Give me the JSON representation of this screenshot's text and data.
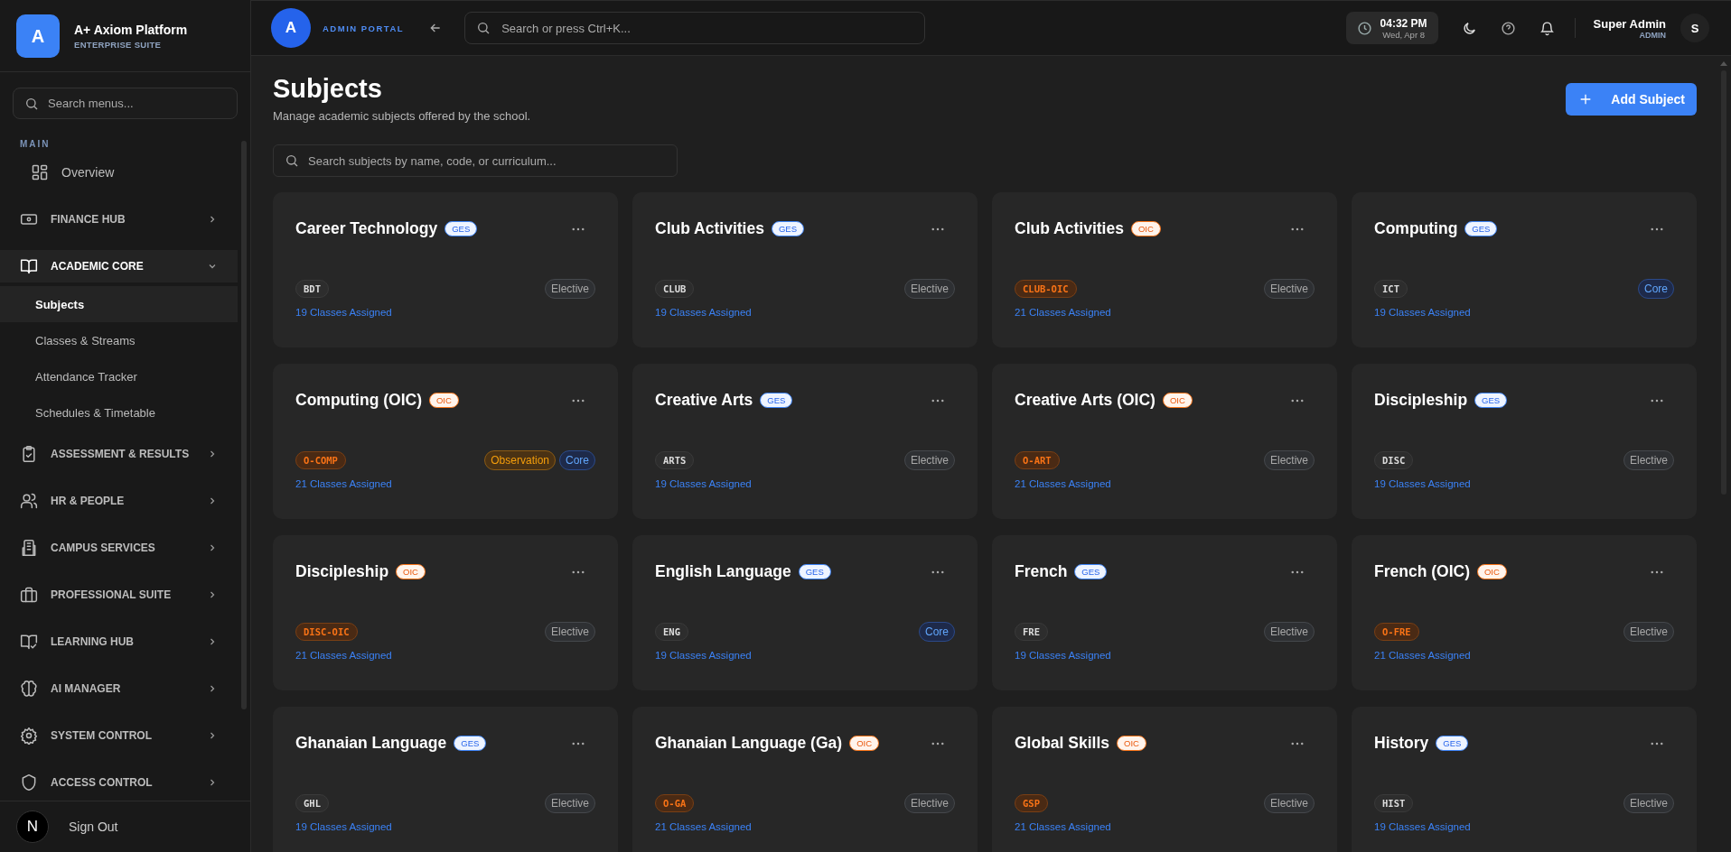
{
  "sidebar": {
    "brand": {
      "logo": "A",
      "title": "A+ Axiom Platform",
      "subtitle": "ENTERPRISE SUITE"
    },
    "search": {
      "placeholder": "Search menus..."
    },
    "section_label": "MAIN",
    "items": [
      {
        "label": "Overview",
        "kind": "link"
      },
      {
        "label": "FINANCE HUB",
        "kind": "group",
        "expanded": false
      },
      {
        "label": "ACADEMIC CORE",
        "kind": "group",
        "expanded": true,
        "children": [
          {
            "label": "Subjects",
            "selected": true
          },
          {
            "label": "Classes & Streams",
            "selected": false
          },
          {
            "label": "Attendance Tracker",
            "selected": false
          },
          {
            "label": "Schedules & Timetable",
            "selected": false
          }
        ]
      },
      {
        "label": "ASSESSMENT & RESULTS",
        "kind": "group",
        "expanded": false
      },
      {
        "label": "HR & PEOPLE",
        "kind": "group",
        "expanded": false
      },
      {
        "label": "CAMPUS SERVICES",
        "kind": "group",
        "expanded": false
      },
      {
        "label": "PROFESSIONAL SUITE",
        "kind": "group",
        "expanded": false
      },
      {
        "label": "LEARNING HUB",
        "kind": "group",
        "expanded": false
      },
      {
        "label": "AI MANAGER",
        "kind": "group",
        "expanded": false
      },
      {
        "label": "SYSTEM CONTROL",
        "kind": "group",
        "expanded": false
      },
      {
        "label": "ACCESS CONTROL",
        "kind": "group",
        "expanded": false
      }
    ],
    "footer": {
      "avatar": "N",
      "label": "Sign Out"
    }
  },
  "topbar": {
    "logo": "A",
    "portal": "ADMIN PORTAL",
    "search": {
      "placeholder": "Search or press Ctrl+K..."
    },
    "time": "04:32 PM",
    "date": "Wed, Apr 8",
    "user": {
      "name": "Super Admin",
      "role": "ADMIN",
      "avatar": "S"
    }
  },
  "page": {
    "title": "Subjects",
    "subtitle": "Manage academic subjects offered by the school.",
    "add_button": "Add Subject",
    "search": {
      "placeholder": "Search subjects by name, code, or curriculum..."
    }
  },
  "subjects": [
    {
      "name": "Career Technology",
      "badge": {
        "label": "GES",
        "kind": "ges"
      },
      "code": "BDT",
      "tags": [
        {
          "label": "Elective",
          "kind": "elective"
        }
      ],
      "classes": "19 Classes Assigned"
    },
    {
      "name": "Club Activities",
      "badge": {
        "label": "GES",
        "kind": "ges"
      },
      "code": "CLUB",
      "tags": [
        {
          "label": "Elective",
          "kind": "elective"
        }
      ],
      "classes": "19 Classes Assigned"
    },
    {
      "name": "Club Activities",
      "badge": {
        "label": "OIC",
        "kind": "oic"
      },
      "code": "CLUB-OIC",
      "tags": [
        {
          "label": "Elective",
          "kind": "elective"
        }
      ],
      "classes": "21 Classes Assigned"
    },
    {
      "name": "Computing",
      "badge": {
        "label": "GES",
        "kind": "ges"
      },
      "code": "ICT",
      "tags": [
        {
          "label": "Core",
          "kind": "core"
        }
      ],
      "classes": "19 Classes Assigned"
    },
    {
      "name": "Computing (OIC)",
      "badge": {
        "label": "OIC",
        "kind": "oic"
      },
      "code": "O-COMP",
      "tags": [
        {
          "label": "Observation",
          "kind": "observation"
        },
        {
          "label": "Core",
          "kind": "core"
        }
      ],
      "classes": "21 Classes Assigned"
    },
    {
      "name": "Creative Arts",
      "badge": {
        "label": "GES",
        "kind": "ges"
      },
      "code": "ARTS",
      "tags": [
        {
          "label": "Elective",
          "kind": "elective"
        }
      ],
      "classes": "19 Classes Assigned"
    },
    {
      "name": "Creative Arts (OIC)",
      "badge": {
        "label": "OIC",
        "kind": "oic"
      },
      "code": "O-ART",
      "tags": [
        {
          "label": "Elective",
          "kind": "elective"
        }
      ],
      "classes": "21 Classes Assigned"
    },
    {
      "name": "Discipleship",
      "badge": {
        "label": "GES",
        "kind": "ges"
      },
      "code": "DISC",
      "tags": [
        {
          "label": "Elective",
          "kind": "elective"
        }
      ],
      "classes": "19 Classes Assigned"
    },
    {
      "name": "Discipleship",
      "badge": {
        "label": "OIC",
        "kind": "oic"
      },
      "code": "DISC-OIC",
      "tags": [
        {
          "label": "Elective",
          "kind": "elective"
        }
      ],
      "classes": "21 Classes Assigned"
    },
    {
      "name": "English Language",
      "badge": {
        "label": "GES",
        "kind": "ges"
      },
      "code": "ENG",
      "tags": [
        {
          "label": "Core",
          "kind": "core"
        }
      ],
      "classes": "19 Classes Assigned"
    },
    {
      "name": "French",
      "badge": {
        "label": "GES",
        "kind": "ges"
      },
      "code": "FRE",
      "tags": [
        {
          "label": "Elective",
          "kind": "elective"
        }
      ],
      "classes": "19 Classes Assigned"
    },
    {
      "name": "French (OIC)",
      "badge": {
        "label": "OIC",
        "kind": "oic"
      },
      "code": "O-FRE",
      "tags": [
        {
          "label": "Elective",
          "kind": "elective"
        }
      ],
      "classes": "21 Classes Assigned"
    },
    {
      "name": "Ghanaian Language",
      "badge": {
        "label": "GES",
        "kind": "ges"
      },
      "code": "GHL",
      "tags": [
        {
          "label": "Elective",
          "kind": "elective"
        }
      ],
      "classes": "19 Classes Assigned"
    },
    {
      "name": "Ghanaian Language (Ga)",
      "badge": {
        "label": "OIC",
        "kind": "oic"
      },
      "code": "O-GA",
      "tags": [
        {
          "label": "Elective",
          "kind": "elective"
        }
      ],
      "classes": "21 Classes Assigned"
    },
    {
      "name": "Global Skills",
      "badge": {
        "label": "OIC",
        "kind": "oic"
      },
      "code": "GSP",
      "tags": [
        {
          "label": "Elective",
          "kind": "elective"
        }
      ],
      "classes": "21 Classes Assigned"
    },
    {
      "name": "History",
      "badge": {
        "label": "GES",
        "kind": "ges"
      },
      "code": "HIST",
      "tags": [
        {
          "label": "Elective",
          "kind": "elective"
        }
      ],
      "classes": "19 Classes Assigned"
    }
  ]
}
